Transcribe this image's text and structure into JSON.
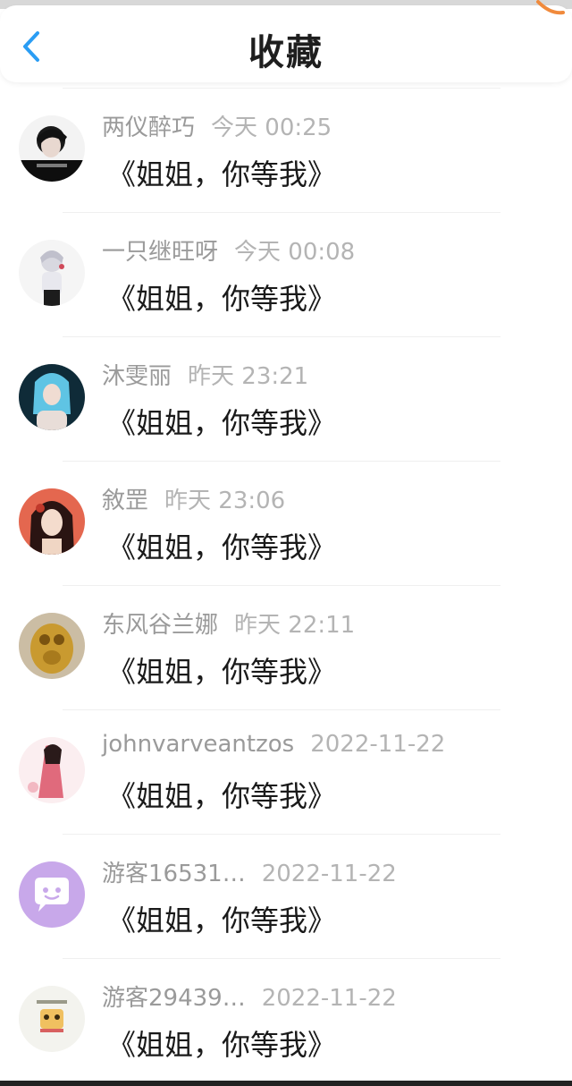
{
  "header": {
    "title": "收藏",
    "back_icon": "chevron-left-icon",
    "accent_color": "#2a9df4"
  },
  "favorites": [
    {
      "user": "两仪醉巧",
      "time": "今天 00:25",
      "content": "《姐姐，你等我》",
      "avatar_colors": [
        "#f2f2f2",
        "#111111"
      ]
    },
    {
      "user": "一只继旺呀",
      "time": "今天 00:08",
      "content": "《姐姐，你等我》",
      "avatar_colors": [
        "#f5f5f5",
        "#b8b8c8"
      ]
    },
    {
      "user": "沐雯丽",
      "time": "昨天 23:21",
      "content": "《姐姐，你等我》",
      "avatar_colors": [
        "#0d2a36",
        "#6cc8e6"
      ]
    },
    {
      "user": "敘罡",
      "time": "昨天 23:06",
      "content": "《姐姐，你等我》",
      "avatar_colors": [
        "#e4674f",
        "#3a1a1a"
      ]
    },
    {
      "user": "东风谷兰娜",
      "time": "昨天 22:11",
      "content": "《姐姐，你等我》",
      "avatar_colors": [
        "#c9b89a",
        "#b88a2e"
      ]
    },
    {
      "user": "johnvarveantzos",
      "time": "2022-11-22",
      "content": "《姐姐，你等我》",
      "avatar_colors": [
        "#fbe9ec",
        "#d65a6e"
      ]
    },
    {
      "user": "游客16531…",
      "time": "2022-11-22",
      "content": "《姐姐，你等我》",
      "avatar_colors": [
        "#c9a8ea",
        "#ffffff"
      ]
    },
    {
      "user": "游客29439…",
      "time": "2022-11-22",
      "content": "《姐姐，你等我》",
      "avatar_colors": [
        "#f4f4f0",
        "#e0a040"
      ]
    }
  ]
}
